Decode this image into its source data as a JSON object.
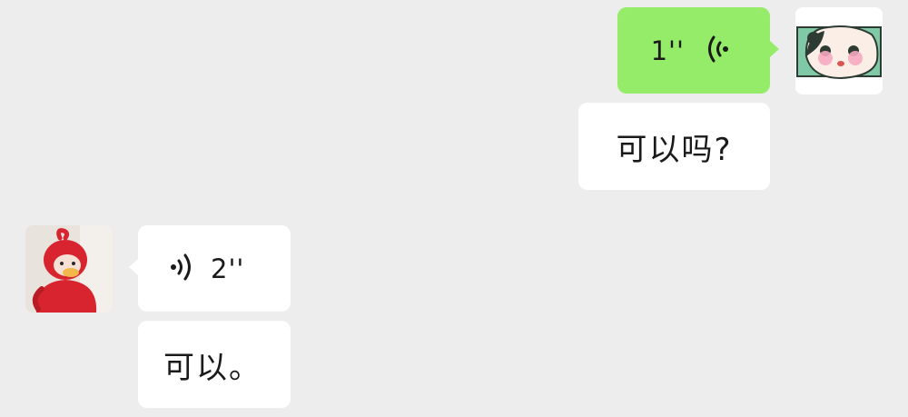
{
  "messages": [
    {
      "sender": "me",
      "type": "voice",
      "duration": "1''",
      "icon": "voice-wave-icon"
    },
    {
      "sender": "me",
      "type": "text",
      "text": "可以吗?"
    },
    {
      "sender": "other",
      "type": "voice",
      "duration": "2''",
      "icon": "voice-wave-icon"
    },
    {
      "sender": "other",
      "type": "text",
      "text": "可以。"
    }
  ],
  "avatars": {
    "me": "cartoon-girl-avatar",
    "other": "red-duck-plush-avatar"
  },
  "colors": {
    "background": "#ededed",
    "sent_bubble": "#95ec69",
    "received_bubble": "#ffffff"
  }
}
